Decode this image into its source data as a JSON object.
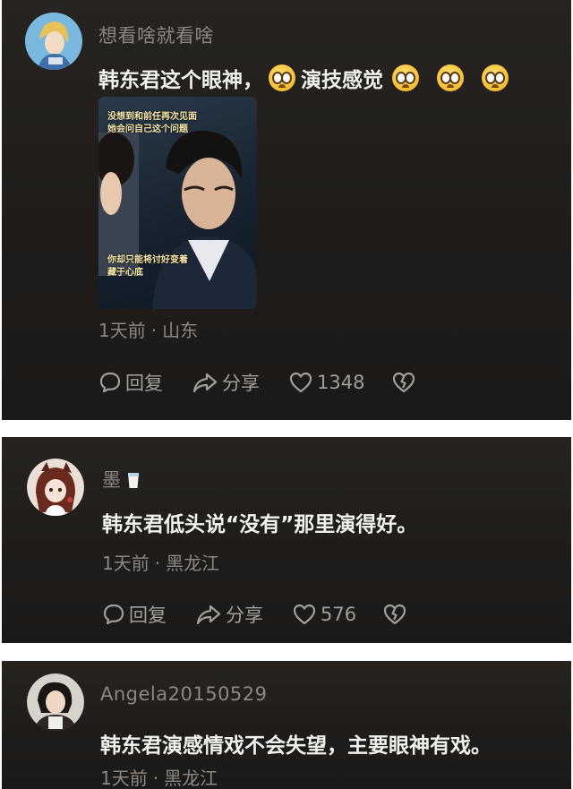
{
  "comments": [
    {
      "username": "想看啥就看啥",
      "text_before": "韩东君这个眼神，",
      "text_mid": "演技感觉",
      "emoji_icon": "pleading-face-emoji",
      "video": {
        "caption_top": "没想到和前任再次见面",
        "caption_top2": "她会问自己这个问题",
        "caption_bottom": "你却只能将讨好变着",
        "caption_bottom2": "藏于心底"
      },
      "time": "1天前",
      "location": "山东",
      "reply_label": "回复",
      "share_label": "分享",
      "likes": "1348"
    },
    {
      "username": "墨",
      "username_icon": "cup-icon",
      "text": "韩东君低头说“没有”那里演得好。",
      "time": "1天前",
      "location": "黑龙江",
      "reply_label": "回复",
      "share_label": "分享",
      "likes": "576"
    },
    {
      "username": "Angela20150529",
      "text": "韩东君演感情戏不会失望，主要眼神有戏。",
      "time": "1天前",
      "location": "黑龙江"
    }
  ],
  "colors": {
    "card_bg": "#232020",
    "text_primary": "#f2f0ec",
    "text_secondary": "#8c8782"
  }
}
